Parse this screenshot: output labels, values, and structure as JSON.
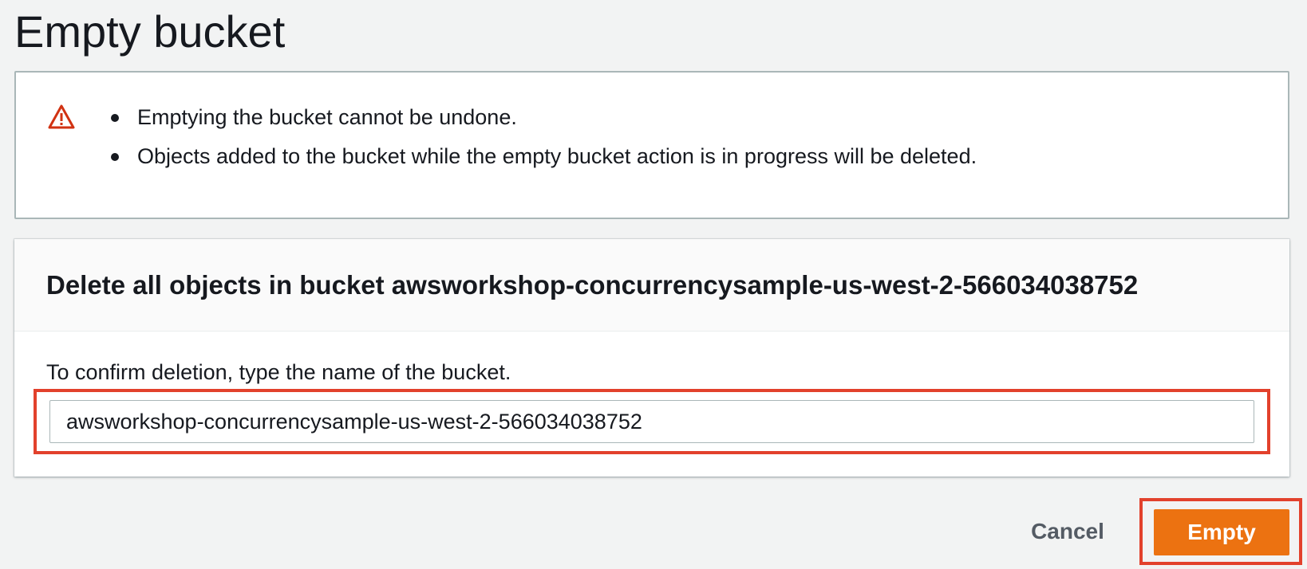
{
  "page": {
    "title": "Empty bucket"
  },
  "warning": {
    "icon": "warning-icon",
    "icon_color": "#d13212",
    "items": [
      "Emptying the bucket cannot be undone.",
      "Objects added to the bucket while the empty bucket action is in progress will be deleted."
    ]
  },
  "confirm": {
    "heading": "Delete all objects in bucket awsworkshop-concurrencysample-us-west-2-566034038752",
    "label": "To confirm deletion, type the name of the bucket.",
    "input_value": "awsworkshop-concurrencysample-us-west-2-566034038752"
  },
  "actions": {
    "cancel_label": "Cancel",
    "empty_label": "Empty",
    "primary_color": "#ec7211",
    "highlight_color": "#e2412c"
  }
}
